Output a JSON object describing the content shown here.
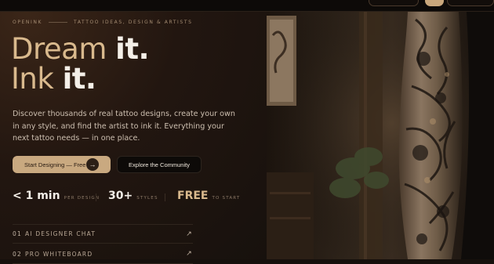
{
  "brand": "OPENINK",
  "tagline": "TATTOO IDEAS, DESIGN & ARTISTS",
  "headline": {
    "line1_accent": "Dream",
    "line1_plain": "it.",
    "line2_accent": "Ink",
    "line2_plain": "it."
  },
  "description": "Discover thousands of real tattoo designs, create your own in any style, and find the artist to ink it. Everything your next tattoo needs — in one place.",
  "cta": {
    "primary_label": "Start Designing — Free",
    "primary_icon": "arrow-right-icon",
    "secondary_label": "Explore the Community"
  },
  "stats": [
    {
      "value": "< 1 min",
      "label": "PER DESIGN"
    },
    {
      "value": "30+",
      "label": "STYLES"
    },
    {
      "value": "FREE",
      "label": "TO START"
    }
  ],
  "features": [
    {
      "num": "01",
      "title": "AI DESIGNER CHAT",
      "icon": "arrow-up-right-icon"
    },
    {
      "num": "02",
      "title": "PRO WHITEBOARD",
      "icon": "arrow-up-right-icon"
    }
  ],
  "colors": {
    "accent": "#d9b98d",
    "button_primary": "#c9a980",
    "background": "#16100c"
  }
}
